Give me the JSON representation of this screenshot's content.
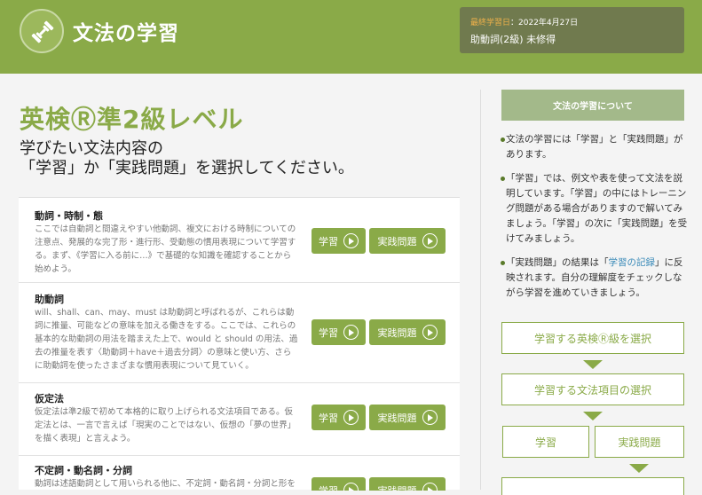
{
  "header": {
    "title": "文法の学習",
    "logo_icon": "dumbbell-icon",
    "status_label": "最終学習日",
    "status_date": "：2022年4月27日",
    "status_text": "助動詞(2級) 未修得"
  },
  "main": {
    "level_title": "英検Ⓡ準2級レベル",
    "lead_line1": "学びたい文法内容の",
    "lead_line2": "「学習」か「実践問題」を選択してください。",
    "items": [
      {
        "title": "動詞・時制・態",
        "desc": "ここでは自動詞と間違えやすい他動詞、複文における時制についての注意点、発展的な完了形・進行形、受動態の慣用表現について学習する。まず、《学習に入る前に…》で基礎的な知識を確認することから始めよう。",
        "study_label": "学習",
        "practice_label": "実践問題"
      },
      {
        "title": "助動詞",
        "desc": "will、shall、can、may、must は助動詞と呼ばれるが、これらは動詞に推量、可能などの意味を加える働きをする。ここでは、これらの基本的な助動詞の用法を踏まえた上で、would と should の用法、過去の推量を表す〈助動詞＋have＋過去分詞〉の意味と使い方、さらに助動詞を使ったさまざまな慣用表現について見ていく。",
        "study_label": "学習",
        "practice_label": "実践問題"
      },
      {
        "title": "仮定法",
        "desc": "仮定法は準2級で初めて本格的に取り上げられる文法項目である。仮定法とは、一言で言えば「現実のことではない、仮想の「夢の世界」を描く表現」と言えよう。",
        "study_label": "学習",
        "practice_label": "実践問題"
      },
      {
        "title": "不定詞・動名詞・分詞",
        "desc": "動詞は述語動詞として用いられる他に、不定詞・動名詞・分詞と形を変",
        "study_label": "学習",
        "practice_label": "実践問題"
      }
    ]
  },
  "side": {
    "heading": "文法の学習について",
    "bullet1": "文法の学習には「学習」と「実践問題」があります。",
    "bullet2": "「学習」では、例文や表を使って文法を説明しています。「学習」の中にはトレーニング問題がある場合がありますので解いてみましょう。「学習」の次に「実践問題」を受けてみましょう。",
    "bullet3_pre": "「実践問題」の結果は「",
    "bullet3_link": "学習の記録",
    "bullet3_post": "」に反映されます。自分の理解度をチェックしながら学習を進めていきましょう。",
    "flow1": "学習する英検Ⓡ級を選択",
    "flow2": "学習する文法項目の選択",
    "flow3a": "学習",
    "flow3b": "実践問題"
  },
  "colors": {
    "accent": "#8aaa48",
    "status_bg": "#707a4e",
    "side_head": "#a3b98a",
    "link": "#3a8ab8"
  }
}
